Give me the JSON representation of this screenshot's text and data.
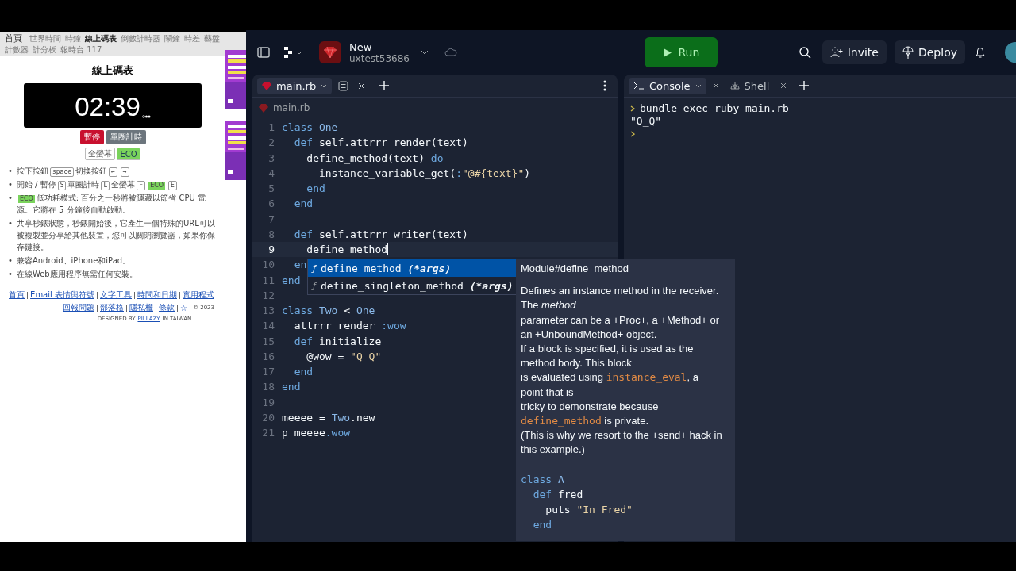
{
  "stopwatch_page": {
    "nav": [
      {
        "label": "首頁",
        "selected": false
      },
      {
        "label": "世界時間",
        "selected": false
      },
      {
        "label": "時鐘",
        "selected": false
      },
      {
        "label": "線上碼表",
        "selected": true
      },
      {
        "label": "倒數計時器",
        "selected": false
      },
      {
        "label": "鬧鐘",
        "selected": false
      },
      {
        "label": "時差",
        "selected": false
      },
      {
        "label": "藝盤",
        "selected": false
      },
      {
        "label": "計數器",
        "selected": false
      },
      {
        "label": "計分板",
        "selected": false
      },
      {
        "label": "報時台 117",
        "selected": false
      }
    ],
    "title": "線上碼表",
    "time": "02:39",
    "buttons": [
      {
        "label": "暫停",
        "kind": "danger"
      },
      {
        "label": "單圈計時",
        "kind": "secondary"
      }
    ],
    "toggles": [
      {
        "label": "全螢幕",
        "on": false
      },
      {
        "label": "ECO",
        "on": true
      }
    ],
    "bullets": [
      {
        "marker": "•",
        "parts": [
          {
            "text": "按下按鈕",
            "kind": "text"
          },
          {
            "text": "space",
            "kind": "key"
          },
          {
            "text": "切換按鈕",
            "kind": "text"
          },
          {
            "text": "←",
            "kind": "key"
          },
          {
            "text": "→",
            "kind": "key"
          }
        ]
      },
      {
        "marker": "•",
        "parts": [
          {
            "text": "開始 / 暫停",
            "kind": "text"
          },
          {
            "text": "S",
            "kind": "key"
          },
          {
            "text": "單圈計時",
            "kind": "text"
          },
          {
            "text": "L",
            "kind": "key"
          },
          {
            "text": "全螢幕",
            "kind": "text"
          },
          {
            "text": "F",
            "kind": "key"
          },
          {
            "text": "ECO",
            "kind": "eco"
          },
          {
            "text": "E",
            "kind": "key"
          }
        ]
      },
      {
        "marker": "•",
        "parts": [
          {
            "text": "ECO",
            "kind": "eco"
          },
          {
            "text": "低功耗模式: 百分之一秒將被隱藏以節省 CPU 電源。它將在 5 分鐘後自動啟動。",
            "kind": "text"
          }
        ]
      },
      {
        "marker": "•",
        "parts": [
          {
            "text": "共享秒錶狀態，秒錶開始後，它產生一個特殊的URL可以被複製並分享給其他裝置，您可以關閉瀏覽器，如果你保存鏈接。",
            "kind": "text"
          }
        ]
      },
      {
        "marker": "•",
        "parts": [
          {
            "text": "兼容Android、iPhone和iPad。",
            "kind": "text"
          }
        ]
      },
      {
        "marker": "•",
        "parts": [
          {
            "text": "在線Web應用程序無需任何安裝。",
            "kind": "text"
          }
        ]
      }
    ],
    "footer_links": [
      [
        "首頁",
        "Email 表情與符號",
        "文字工具",
        "時間和日期",
        "實用程式"
      ],
      [
        "回報問題",
        "部落格",
        "隱私權",
        "條款",
        "☆"
      ]
    ],
    "copyright": "© 2023",
    "credit": [
      "DESIGNED BY",
      "PILLAZY",
      "IN TAIWAN"
    ],
    "ads": [
      {
        "kind": "picture"
      },
      {
        "kind": "picture"
      }
    ]
  },
  "topbar": {
    "repl_name": "New",
    "owner": "uxtest53686",
    "run": "Run",
    "invite": "Invite",
    "deploy": "Deploy"
  },
  "editor": {
    "tabs": [
      {
        "label": "main.rb",
        "selected": true
      }
    ],
    "breadcrumb": "main.rb",
    "lines": [
      {
        "n": "1",
        "current": false,
        "tokens": [
          {
            "text": "class ",
            "kind": "kw"
          },
          {
            "text": "One",
            "kind": "const"
          }
        ]
      },
      {
        "n": "2",
        "current": false,
        "tokens": [
          {
            "text": "  def ",
            "kind": "kw"
          },
          {
            "text": "self.attrrr_render(text)",
            "kind": "plain"
          }
        ]
      },
      {
        "n": "3",
        "current": false,
        "tokens": [
          {
            "text": "    define_method(text) ",
            "kind": "plain"
          },
          {
            "text": "do",
            "kind": "kw"
          }
        ]
      },
      {
        "n": "4",
        "current": false,
        "tokens": [
          {
            "text": "      instance_variable_get(",
            "kind": "plain"
          },
          {
            "text": ":",
            "kind": "sym"
          },
          {
            "text": "\"@#{text}\"",
            "kind": "str"
          },
          {
            "text": ")",
            "kind": "plain"
          }
        ]
      },
      {
        "n": "5",
        "current": false,
        "tokens": [
          {
            "text": "    end",
            "kind": "kw"
          }
        ]
      },
      {
        "n": "6",
        "current": false,
        "tokens": [
          {
            "text": "  end",
            "kind": "kw"
          }
        ]
      },
      {
        "n": "7",
        "current": false
      },
      {
        "n": "8",
        "current": false,
        "tokens": [
          {
            "text": "  def ",
            "kind": "kw"
          },
          {
            "text": "self.attrrr_writer(text)",
            "kind": "plain"
          }
        ]
      },
      {
        "n": "9",
        "current": true,
        "tokens": [
          {
            "text": "    define_method",
            "kind": "plain"
          }
        ]
      },
      {
        "n": "10",
        "current": false,
        "tokens": [
          {
            "text": "  en",
            "kind": "kw"
          }
        ]
      },
      {
        "n": "11",
        "current": false,
        "tokens": [
          {
            "text": "end",
            "kind": "kw"
          }
        ]
      },
      {
        "n": "12",
        "current": false
      },
      {
        "n": "13",
        "current": false,
        "tokens": [
          {
            "text": "class ",
            "kind": "kw"
          },
          {
            "text": "Two",
            "kind": "const"
          },
          {
            "text": " < ",
            "kind": "plain"
          },
          {
            "text": "One",
            "kind": "const"
          }
        ]
      },
      {
        "n": "14",
        "current": false,
        "tokens": [
          {
            "text": "  attrrr_render ",
            "kind": "plain"
          },
          {
            "text": ":wow",
            "kind": "sym"
          }
        ]
      },
      {
        "n": "15",
        "current": false,
        "tokens": [
          {
            "text": "  def ",
            "kind": "kw"
          },
          {
            "text": "initialize",
            "kind": "plain"
          }
        ]
      },
      {
        "n": "16",
        "current": false,
        "tokens": [
          {
            "text": "    @wow = ",
            "kind": "plain"
          },
          {
            "text": "\"Q_Q\"",
            "kind": "str"
          }
        ]
      },
      {
        "n": "17",
        "current": false,
        "tokens": [
          {
            "text": "  end",
            "kind": "kw"
          }
        ]
      },
      {
        "n": "18",
        "current": false,
        "tokens": [
          {
            "text": "end",
            "kind": "kw"
          }
        ]
      },
      {
        "n": "19",
        "current": false
      },
      {
        "n": "20",
        "current": false,
        "tokens": [
          {
            "text": "meeee = ",
            "kind": "plain"
          },
          {
            "text": "Two",
            "kind": "const"
          },
          {
            "text": ".new",
            "kind": "plain"
          }
        ]
      },
      {
        "n": "21",
        "current": false,
        "tokens": [
          {
            "text": "p meeee",
            "kind": "plain"
          },
          {
            "text": ".wow",
            "kind": "sym"
          }
        ]
      }
    ],
    "completions": [
      {
        "icon": "ƒ",
        "name": "define_method",
        "args": "(*args)",
        "selected": true
      },
      {
        "icon": "ƒ",
        "name": "define_singleton_method",
        "args": "(*args)",
        "selected": false
      }
    ],
    "doc": {
      "title": "Module#define_method",
      "lines": [
        [
          {
            "text": "Defines an instance method in the receiver.",
            "kind": "text"
          }
        ],
        [
          {
            "text": "The ",
            "kind": "text"
          },
          {
            "text": "method",
            "kind": "em"
          }
        ],
        [
          {
            "text": "parameter can be a +Proc+, a +Method+ or",
            "kind": "text"
          }
        ],
        [
          {
            "text": "an +UnboundMethod+ object.",
            "kind": "text"
          }
        ],
        [
          {
            "text": "If a block is specified, it is used as the",
            "kind": "text"
          }
        ],
        [
          {
            "text": "method body. This block",
            "kind": "text"
          }
        ],
        [
          {
            "text": "is evaluated using ",
            "kind": "text"
          },
          {
            "text": "instance_eval",
            "kind": "code"
          },
          {
            "text": ", a",
            "kind": "text"
          }
        ],
        [
          {
            "text": "point that is",
            "kind": "text"
          }
        ],
        [
          {
            "text": "tricky to demonstrate because",
            "kind": "text"
          }
        ],
        [
          {
            "text": "define_method",
            "kind": "code"
          },
          {
            "text": " is private.",
            "kind": "text"
          }
        ],
        [
          {
            "text": "(This is why we resort to the +send+ hack in",
            "kind": "text"
          }
        ],
        [
          {
            "text": "this example.)",
            "kind": "text"
          }
        ]
      ],
      "example": [
        [
          {
            "text": "class ",
            "kind": "kw"
          },
          {
            "text": "A",
            "kind": "const"
          }
        ],
        [
          {
            "text": "  def ",
            "kind": "kw"
          },
          {
            "text": "fred",
            "kind": "plain"
          }
        ],
        [
          {
            "text": "    puts ",
            "kind": "plain"
          },
          {
            "text": "\"In Fred\"",
            "kind": "str"
          }
        ],
        [
          {
            "text": "  end",
            "kind": "kw"
          }
        ]
      ]
    }
  },
  "console": {
    "tabs": [
      {
        "label": "Console",
        "selected": true
      },
      {
        "label": "Shell",
        "selected": false
      }
    ],
    "lines": [
      {
        "kind": "command",
        "text": "bundle exec ruby main.rb"
      },
      {
        "kind": "output",
        "text": "\"Q_Q\""
      },
      {
        "kind": "prompt"
      }
    ]
  }
}
